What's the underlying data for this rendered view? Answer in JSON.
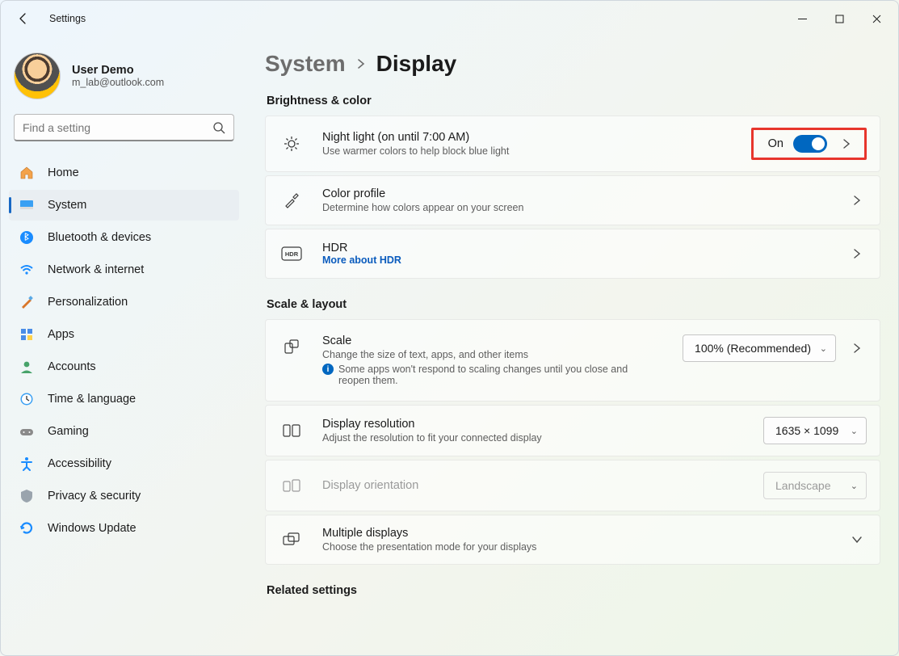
{
  "window": {
    "title": "Settings"
  },
  "profile": {
    "name": "User Demo",
    "email": "m_lab@outlook.com"
  },
  "search": {
    "placeholder": "Find a setting"
  },
  "nav": [
    {
      "key": "home",
      "label": "Home"
    },
    {
      "key": "system",
      "label": "System",
      "active": true
    },
    {
      "key": "bluetooth",
      "label": "Bluetooth & devices"
    },
    {
      "key": "network",
      "label": "Network & internet"
    },
    {
      "key": "personalization",
      "label": "Personalization"
    },
    {
      "key": "apps",
      "label": "Apps"
    },
    {
      "key": "accounts",
      "label": "Accounts"
    },
    {
      "key": "time",
      "label": "Time & language"
    },
    {
      "key": "gaming",
      "label": "Gaming"
    },
    {
      "key": "accessibility",
      "label": "Accessibility"
    },
    {
      "key": "privacy",
      "label": "Privacy & security"
    },
    {
      "key": "update",
      "label": "Windows Update"
    }
  ],
  "breadcrumb": {
    "parent": "System",
    "current": "Display"
  },
  "sections": {
    "brightness": {
      "title": "Brightness & color",
      "night_light": {
        "title": "Night light (on until 7:00 AM)",
        "sub": "Use warmer colors to help block blue light",
        "toggle_label": "On",
        "toggle_on": true
      },
      "color_profile": {
        "title": "Color profile",
        "sub": "Determine how colors appear on your screen"
      },
      "hdr": {
        "title": "HDR",
        "link": "More about HDR"
      }
    },
    "scale": {
      "title": "Scale & layout",
      "scale": {
        "title": "Scale",
        "sub": "Change the size of text, apps, and other items",
        "note": "Some apps won't respond to scaling changes until you close and reopen them.",
        "value": "100% (Recommended)"
      },
      "resolution": {
        "title": "Display resolution",
        "sub": "Adjust the resolution to fit your connected display",
        "value": "1635 × 1099"
      },
      "orientation": {
        "title": "Display orientation",
        "value": "Landscape"
      },
      "multiple": {
        "title": "Multiple displays",
        "sub": "Choose the presentation mode for your displays"
      }
    },
    "related": {
      "title": "Related settings"
    }
  }
}
